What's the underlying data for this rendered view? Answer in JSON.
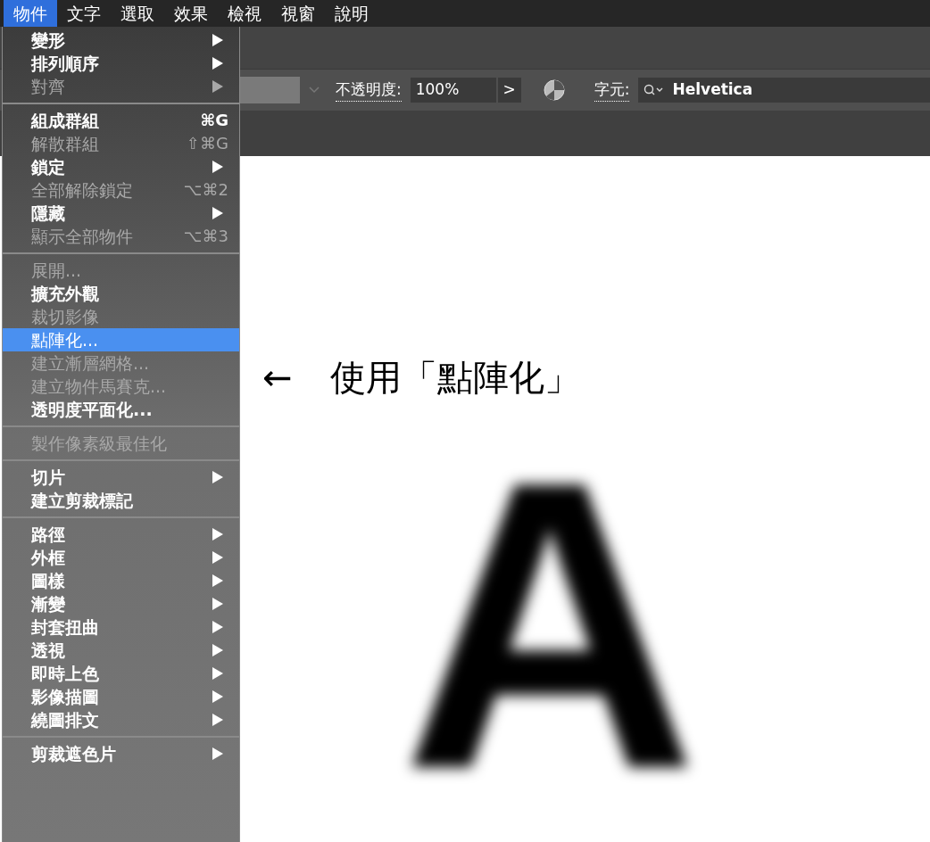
{
  "menubar": [
    {
      "label": "物件",
      "selected": true
    },
    {
      "label": "文字",
      "selected": false
    },
    {
      "label": "選取",
      "selected": false
    },
    {
      "label": "效果",
      "selected": false
    },
    {
      "label": "檢視",
      "selected": false
    },
    {
      "label": "視窗",
      "selected": false
    },
    {
      "label": "說明",
      "selected": false
    }
  ],
  "menu": {
    "groups": [
      [
        {
          "label": "變形",
          "submenu": true,
          "disabled": false,
          "selected": false
        },
        {
          "label": "排列順序",
          "submenu": true,
          "disabled": false,
          "selected": false
        },
        {
          "label": "對齊",
          "submenu": true,
          "disabled": true,
          "selected": false
        }
      ],
      [
        {
          "label": "組成群組",
          "shortcut": "⌘G",
          "submenu": false,
          "disabled": false,
          "selected": false
        },
        {
          "label": "解散群組",
          "shortcut": "⇧⌘G",
          "submenu": false,
          "disabled": true,
          "selected": false
        },
        {
          "label": "鎖定",
          "submenu": true,
          "disabled": false,
          "selected": false
        },
        {
          "label": "全部解除鎖定",
          "shortcut": "⌥⌘2",
          "submenu": false,
          "disabled": true,
          "selected": false
        },
        {
          "label": "隱藏",
          "submenu": true,
          "disabled": false,
          "selected": false
        },
        {
          "label": "顯示全部物件",
          "shortcut": "⌥⌘3",
          "submenu": false,
          "disabled": true,
          "selected": false
        }
      ],
      [
        {
          "label": "展開...",
          "submenu": false,
          "disabled": true,
          "selected": false
        },
        {
          "label": "擴充外觀",
          "submenu": false,
          "disabled": false,
          "selected": false
        },
        {
          "label": "裁切影像",
          "submenu": false,
          "disabled": true,
          "selected": false
        },
        {
          "label": "點陣化...",
          "submenu": false,
          "disabled": false,
          "selected": true
        },
        {
          "label": "建立漸層網格...",
          "submenu": false,
          "disabled": true,
          "selected": false
        },
        {
          "label": "建立物件馬賽克...",
          "submenu": false,
          "disabled": true,
          "selected": false
        },
        {
          "label": "透明度平面化...",
          "submenu": false,
          "disabled": false,
          "selected": false
        }
      ],
      [
        {
          "label": "製作像素級最佳化",
          "submenu": false,
          "disabled": true,
          "selected": false
        }
      ],
      [
        {
          "label": "切片",
          "submenu": true,
          "disabled": false,
          "selected": false
        },
        {
          "label": "建立剪裁標記",
          "submenu": false,
          "disabled": false,
          "selected": false
        }
      ],
      [
        {
          "label": "路徑",
          "submenu": true,
          "disabled": false,
          "selected": false
        },
        {
          "label": "外框",
          "submenu": true,
          "disabled": false,
          "selected": false
        },
        {
          "label": "圖樣",
          "submenu": true,
          "disabled": false,
          "selected": false
        },
        {
          "label": "漸變",
          "submenu": true,
          "disabled": false,
          "selected": false
        },
        {
          "label": "封套扭曲",
          "submenu": true,
          "disabled": false,
          "selected": false
        },
        {
          "label": "透視",
          "submenu": true,
          "disabled": false,
          "selected": false
        },
        {
          "label": "即時上色",
          "submenu": true,
          "disabled": false,
          "selected": false
        },
        {
          "label": "影像描圖",
          "submenu": true,
          "disabled": false,
          "selected": false
        },
        {
          "label": "繞圖排文",
          "submenu": true,
          "disabled": false,
          "selected": false
        }
      ],
      [
        {
          "label": "剪裁遮色片",
          "submenu": true,
          "disabled": false,
          "selected": false
        }
      ]
    ]
  },
  "toolbar": {
    "opacity_label": "不透明度:",
    "opacity_value": "100%",
    "opacity_button": ">",
    "character_label": "字元:",
    "font_value": "Helvetica"
  },
  "canvas": {
    "annotation_arrow": "←",
    "annotation": "使用「點陣化」",
    "letter": "A"
  }
}
